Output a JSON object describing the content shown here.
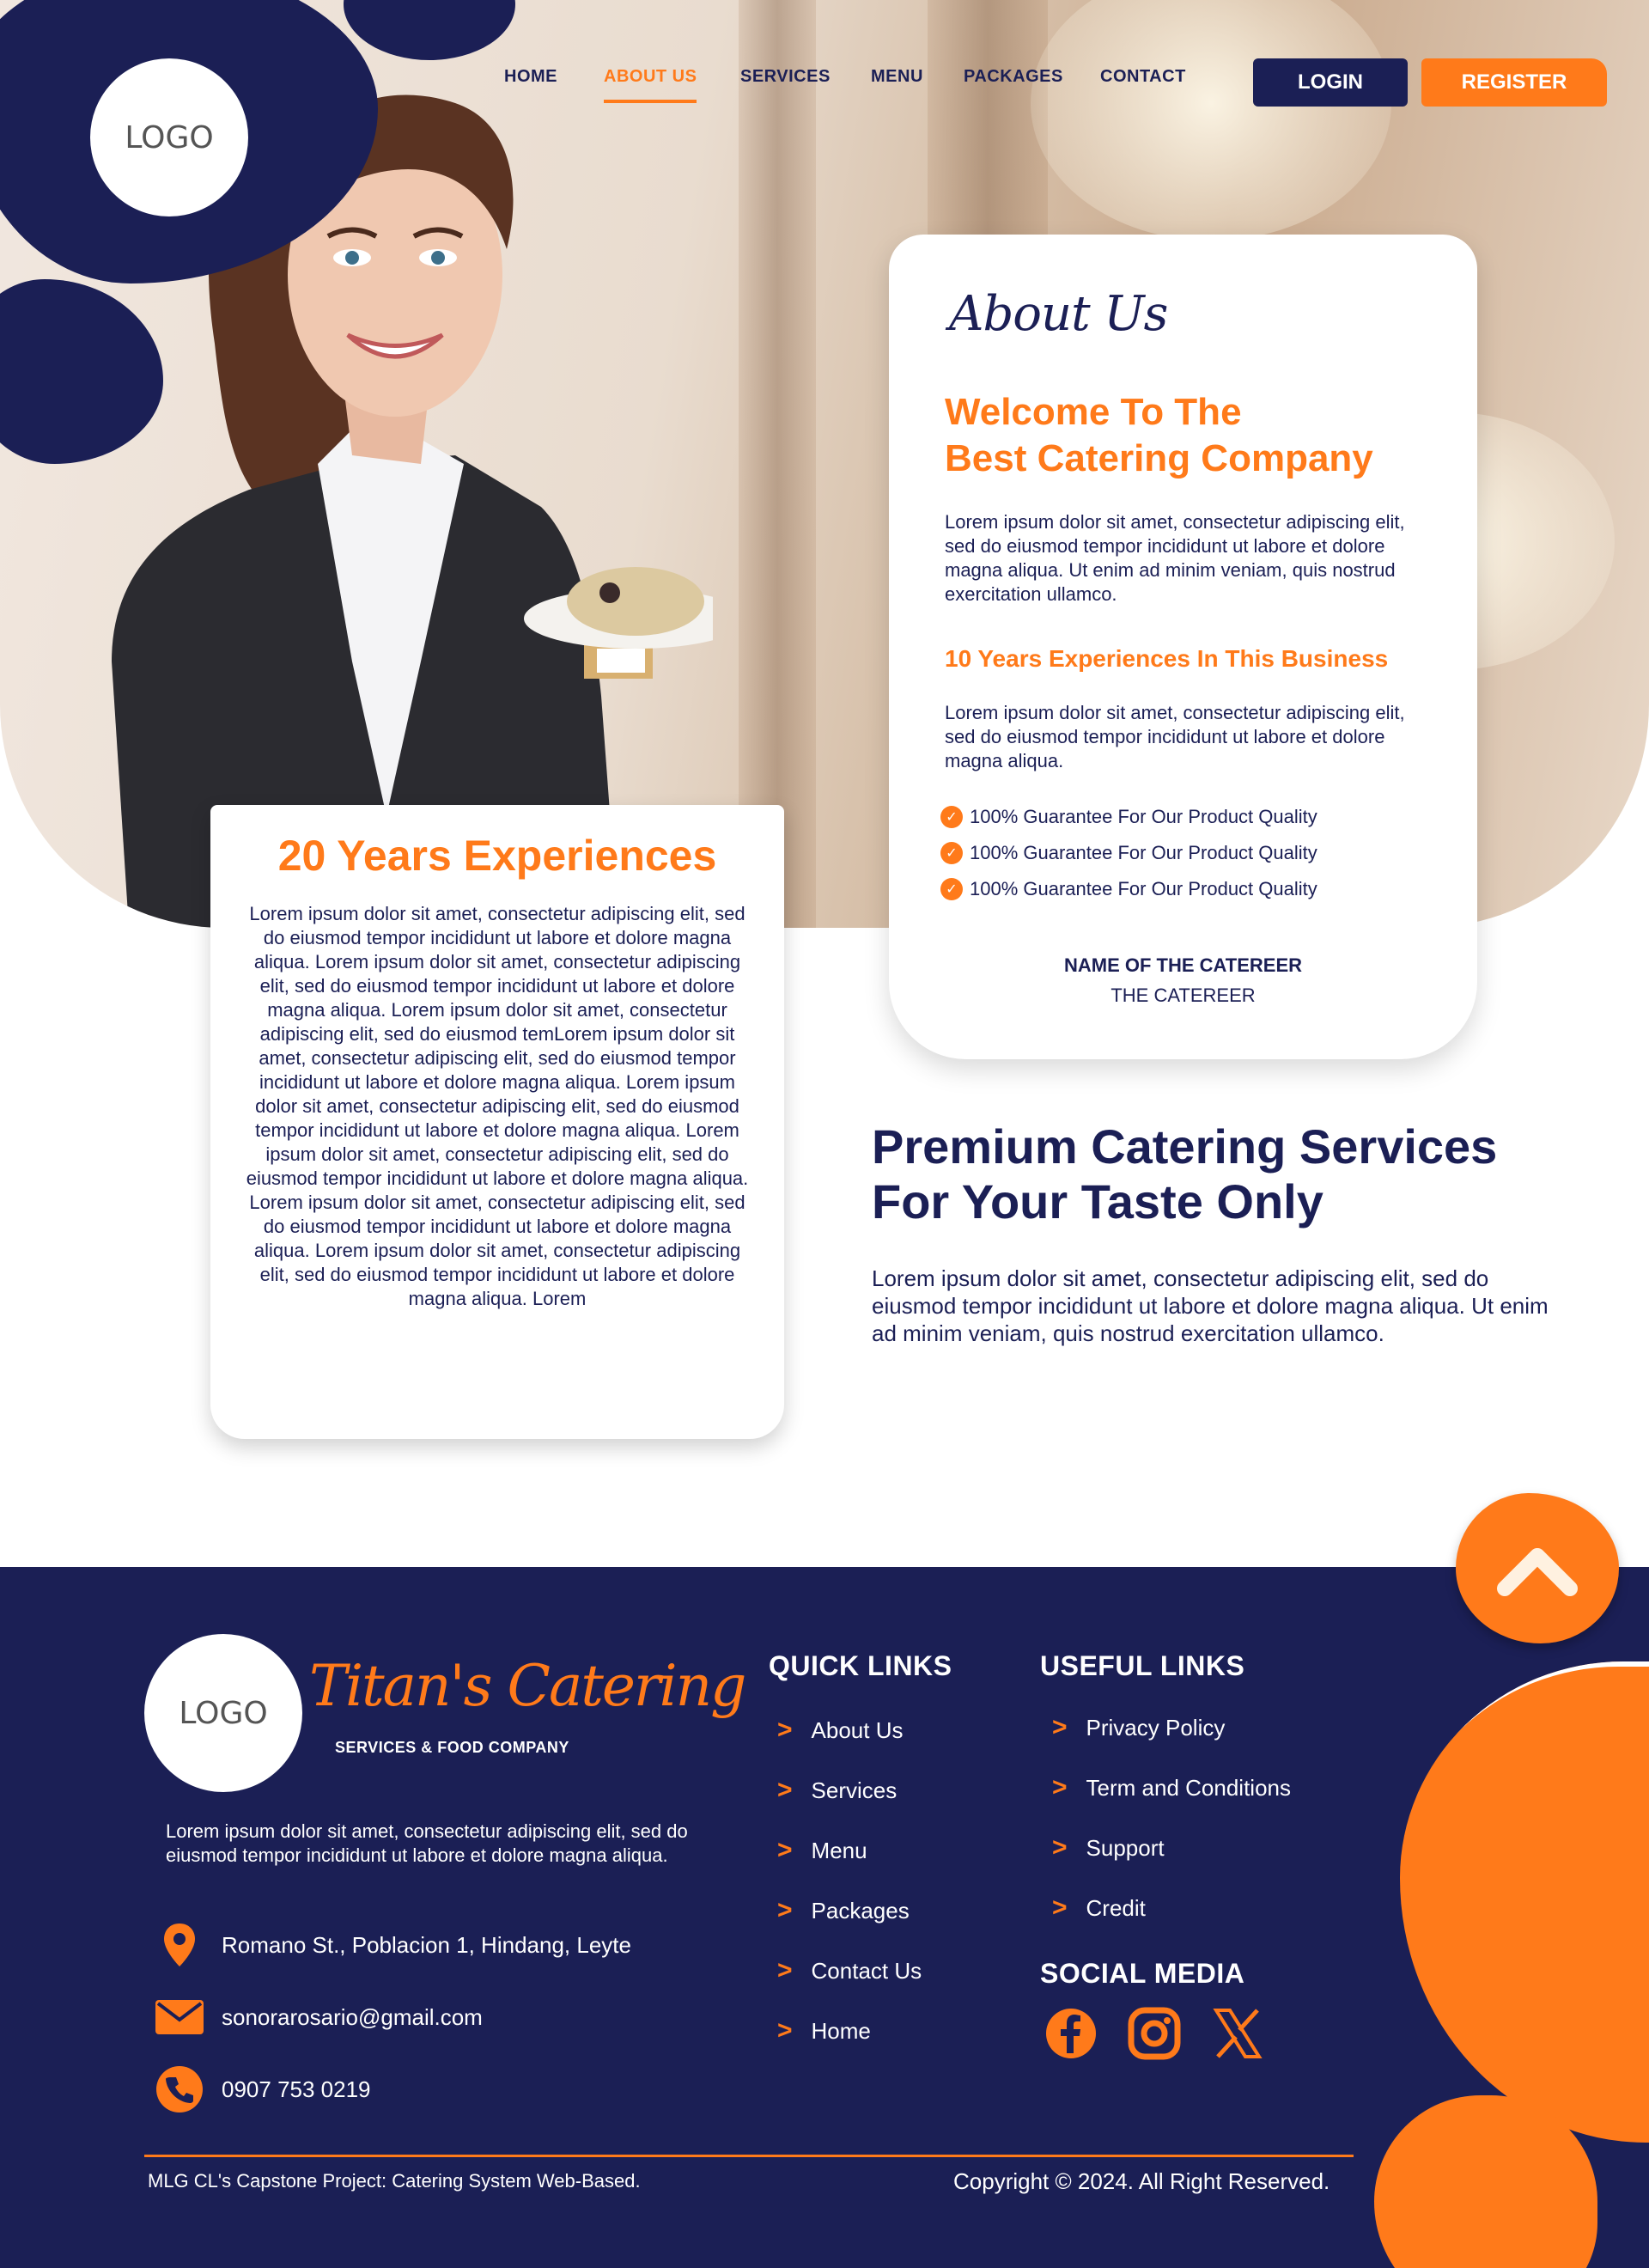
{
  "logo": {
    "label": "LOGO"
  },
  "nav": {
    "items": [
      {
        "label": "HOME",
        "active": false
      },
      {
        "label": "ABOUT US",
        "active": true
      },
      {
        "label": "SERVICES",
        "active": false
      },
      {
        "label": "MENU",
        "active": false
      },
      {
        "label": "PACKAGES",
        "active": false
      },
      {
        "label": "CONTACT",
        "active": false
      }
    ],
    "login_label": "LOGIN",
    "register_label": "REGISTER"
  },
  "about": {
    "script_title": "About Us",
    "title_line1": "Welcome To The",
    "title_line2": "Best Catering Company",
    "paragraph1": "Lorem ipsum dolor sit amet, consectetur adipiscing elit, sed do eiusmod tempor incididunt ut labore et dolore magna aliqua. Ut enim ad minim veniam, quis nostrud exercitation ullamco.",
    "subtitle": "10 Years Experiences In This Business",
    "paragraph2": "Lorem ipsum dolor sit amet, consectetur adipiscing elit, sed do eiusmod tempor incididunt ut labore et dolore magna aliqua.",
    "guarantees": [
      "100% Guarantee For Our Product Quality",
      "100% Guarantee For Our Product Quality",
      "100% Guarantee For Our Product Quality"
    ],
    "caterer_name": "NAME OF THE CATEREER",
    "caterer_role": "THE CATEREER"
  },
  "experience": {
    "title": "20 Years Experiences",
    "body": "Lorem ipsum dolor sit amet, consectetur adipiscing elit, sed do eiusmod tempor incididunt ut labore et dolore magna aliqua. Lorem ipsum dolor sit amet, consectetur adipiscing elit, sed do eiusmod tempor incididunt ut labore et dolore magna aliqua. Lorem ipsum dolor sit amet, consectetur adipiscing elit, sed do eiusmod temLorem ipsum dolor sit amet, consectetur adipiscing elit, sed do eiusmod tempor incididunt ut labore et dolore magna aliqua. Lorem ipsum dolor sit amet, consectetur adipiscing elit, sed do eiusmod tempor incididunt ut labore et dolore magna aliqua. Lorem ipsum dolor sit amet, consectetur adipiscing elit, sed do eiusmod tempor incididunt ut labore et dolore magna aliqua. Lorem ipsum dolor sit amet, consectetur adipiscing elit, sed do eiusmod tempor incididunt ut labore et dolore magna aliqua. Lorem ipsum dolor sit amet, consectetur adipiscing elit, sed do eiusmod tempor incididunt ut labore et dolore magna aliqua. Lorem"
  },
  "premium": {
    "title_line1": "Premium Catering Services",
    "title_line2": "For Your Taste Only",
    "paragraph": "Lorem ipsum dolor sit amet, consectetur adipiscing elit, sed do eiusmod tempor incididunt ut labore et dolore magna aliqua. Ut enim ad minim veniam, quis nostrud exercitation ullamco."
  },
  "footer": {
    "logo_label": "LOGO",
    "brand_script": "Titan's Catering",
    "brand_sub": "SERVICES & FOOD COMPANY",
    "description": "Lorem ipsum dolor sit amet, consectetur adipiscing elit, sed do eiusmod tempor incididunt ut labore et dolore magna aliqua.",
    "address": "Romano St., Poblacion 1, Hindang, Leyte",
    "email": "sonorarosario@gmail.com",
    "phone": "0907 753 0219",
    "quick_links_title": "QUICK LINKS",
    "quick_links": [
      "About Us",
      "Services",
      "Menu",
      "Packages",
      "Contact Us",
      "Home"
    ],
    "useful_links_title": "USEFUL LINKS",
    "useful_links": [
      "Privacy Policy",
      "Term and Conditions",
      "Support",
      "Credit"
    ],
    "social_title": "SOCIAL MEDIA",
    "social_icons": [
      "facebook-icon",
      "instagram-icon",
      "x-icon"
    ],
    "project_note": "MLG CL's Capstone Project: Catering System Web-Based.",
    "copyright": "Copyright © 2024. All Right Reserved."
  },
  "colors": {
    "navy": "#1b1f55",
    "orange": "#ff7a1a",
    "white": "#ffffff"
  }
}
